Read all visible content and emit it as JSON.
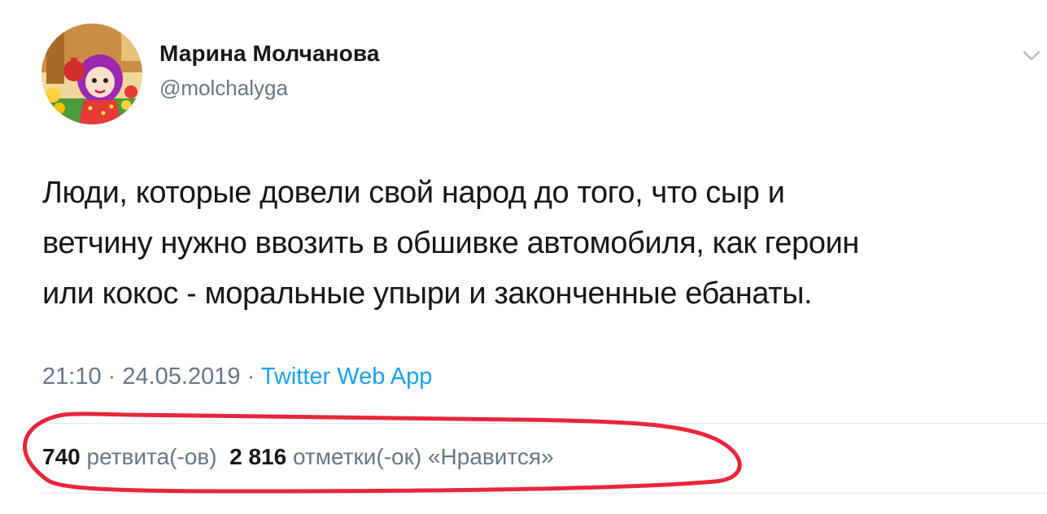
{
  "author": {
    "name": "Марина Молчанова",
    "handle": "@molchalyga",
    "avatar_icon": "cartoon-girl-avatar-icon"
  },
  "menu_icon": "chevron-down-icon",
  "tweet": {
    "lines": [
      "Люди, которые довели свой народ до того, что сыр и",
      "ветчину нужно ввозить в обшивке автомобиля,  как героин",
      "или кокос - моральные упыри и законченные ебанаты."
    ]
  },
  "meta": {
    "time": "21:10",
    "separator": " · ",
    "date": "24.05.2019",
    "source": "Twitter Web App"
  },
  "stats": {
    "retweets_count": "740",
    "retweets_label": "ретвита(-ов)",
    "likes_count": "2 816",
    "likes_label": "отметки(-ок) «Нравится»"
  },
  "colors": {
    "text": "#14171a",
    "muted": "#657786",
    "link": "#1da1f2",
    "divider": "#e1e8ed",
    "annotation": "#e8263a"
  }
}
